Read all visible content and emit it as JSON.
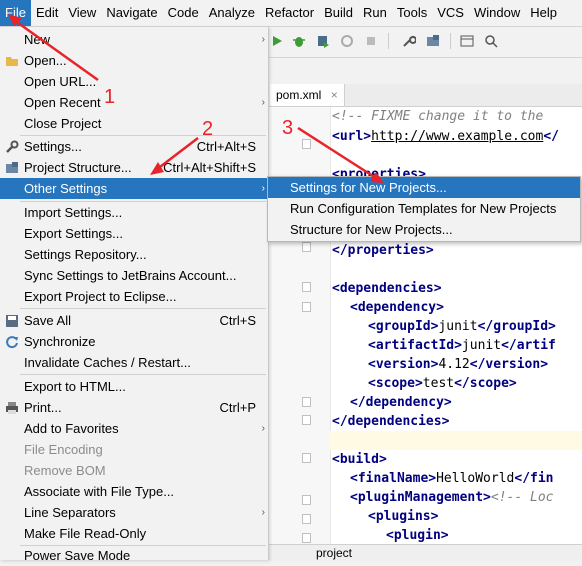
{
  "menubar": [
    "File",
    "Edit",
    "View",
    "Navigate",
    "Code",
    "Analyze",
    "Refactor",
    "Build",
    "Run",
    "Tools",
    "VCS",
    "Window",
    "Help"
  ],
  "tab": {
    "label": "pom.xml",
    "close": "×"
  },
  "status": {
    "label": "project"
  },
  "file_menu": [
    {
      "label": "New",
      "arrow": "›",
      "shortcut": ""
    },
    {
      "label": "Open...",
      "icon": "folder-icon",
      "glyph": "▰"
    },
    {
      "label": "Open URL..."
    },
    {
      "label": "Open Recent",
      "arrow": "›"
    },
    {
      "label": "Close Project"
    },
    {
      "label": "Settings...",
      "shortcut": "Ctrl+Alt+S",
      "icon": "wrench-icon",
      "glyph": "🔧"
    },
    {
      "label": "Project Structure...",
      "shortcut": "Ctrl+Alt+Shift+S",
      "icon": "project-structure-icon",
      "glyph": "▦"
    },
    {
      "label": "Other Settings",
      "arrow": "›"
    },
    {
      "label": "Import Settings..."
    },
    {
      "label": "Export Settings..."
    },
    {
      "label": "Settings Repository..."
    },
    {
      "label": "Sync Settings to JetBrains Account..."
    },
    {
      "label": "Export Project to Eclipse..."
    },
    {
      "label": "Save All",
      "shortcut": "Ctrl+S",
      "icon": "save-icon",
      "glyph": "▣"
    },
    {
      "label": "Synchronize",
      "icon": "sync-icon",
      "glyph": "⟳"
    },
    {
      "label": "Invalidate Caches / Restart..."
    },
    {
      "label": "Export to HTML..."
    },
    {
      "label": "Print...",
      "shortcut": "Ctrl+P",
      "icon": "print-icon",
      "glyph": "⎙"
    },
    {
      "label": "Add to Favorites",
      "arrow": "›"
    },
    {
      "label": "File Encoding"
    },
    {
      "label": "Remove BOM"
    },
    {
      "label": "Associate with File Type..."
    },
    {
      "label": "Line Separators",
      "arrow": "›"
    },
    {
      "label": "Make File Read-Only"
    },
    {
      "label": "Power Save Mode"
    }
  ],
  "submenu": [
    {
      "label": "Settings for New Projects..."
    },
    {
      "label": "Run Configuration Templates for New Projects"
    },
    {
      "label": "Structure for New Projects..."
    }
  ],
  "code": {
    "comment": "<!-- FIXME change it to the",
    "url_open": "<url>",
    "url_text": "http://www.example.com",
    "url_close": "</",
    "properties_open": "<properties>",
    "properties_close": "</properties>",
    "deps_open": "<dependencies>",
    "dep_open": "<dependency>",
    "groupId_open": "<groupId>",
    "groupId_text": "junit",
    "groupId_close": "</groupId>",
    "artifactId_open": "<artifactId>",
    "artifactId_text": "junit",
    "artifactId_close": "</artif",
    "version_open": "<version>",
    "version_text": "4.12",
    "version_close": "</version>",
    "scope_open": "<scope>",
    "scope_text": "test",
    "scope_close": "</scope>",
    "dep_close": "</dependency>",
    "deps_close": "</dependencies>",
    "build_open": "<build>",
    "finalName_open": "<finalName>",
    "finalName_text": "HelloWorld",
    "finalName_close": "</fin",
    "pm_open": "<pluginManagement>",
    "pm_comment": "<!-- Loc",
    "plugins_open": "<plugins>",
    "plugin_open": "<plugin>"
  },
  "annotations": {
    "n1": "1",
    "n2": "2",
    "n3": "3",
    "color": "#e8232a"
  },
  "colors": {
    "selection": "#2675bf",
    "tag": "#000080",
    "comment": "#808080"
  }
}
